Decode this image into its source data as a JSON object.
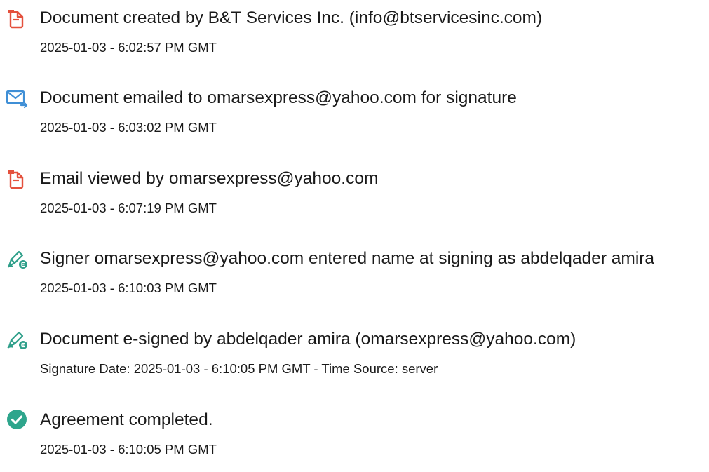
{
  "audit_trail": {
    "events": [
      {
        "icon": "document-created-icon",
        "title": "Document created by B&T Services Inc. (info@btservicesinc.com)",
        "detail": "2025-01-03 - 6:02:57 PM GMT"
      },
      {
        "icon": "email-sent-icon",
        "title": "Document emailed to omarsexpress@yahoo.com for signature",
        "detail": "2025-01-03 - 6:03:02 PM GMT"
      },
      {
        "icon": "email-viewed-icon",
        "title": "Email viewed by omarsexpress@yahoo.com",
        "detail": "2025-01-03 - 6:07:19 PM GMT"
      },
      {
        "icon": "signer-name-entered-icon",
        "title": "Signer omarsexpress@yahoo.com entered name at signing as abdelqader amira",
        "detail": "2025-01-03 - 6:10:03 PM GMT"
      },
      {
        "icon": "e-signed-icon",
        "title": "Document e-signed by abdelqader amira (omarsexpress@yahoo.com)",
        "detail": "Signature Date: 2025-01-03 - 6:10:05 PM GMT - Time Source: server"
      },
      {
        "icon": "agreement-completed-icon",
        "title": "Agreement completed.",
        "detail": "2025-01-03 - 6:10:05 PM GMT"
      }
    ]
  },
  "colors": {
    "document_icon": "#e4513d",
    "email_icon": "#3f8fd6",
    "sign_icon": "#2f9f8a",
    "complete_icon": "#2ea58c",
    "text": "#1a1a1a"
  }
}
